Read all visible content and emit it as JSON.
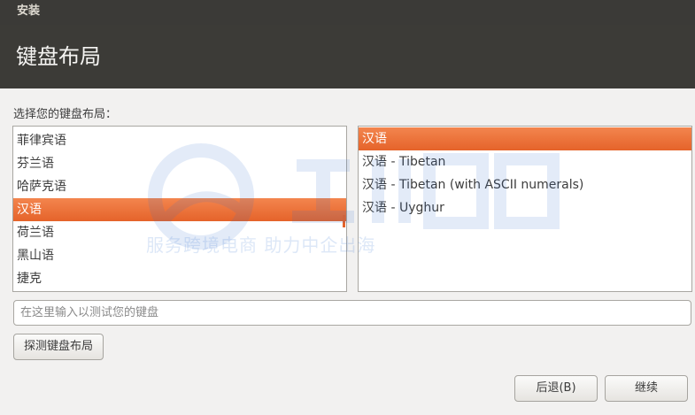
{
  "window": {
    "title": "安装"
  },
  "header": {
    "title": "键盘布局"
  },
  "prompt": "选择您的键盘布局：",
  "layouts": {
    "items": [
      "菲律宾语",
      "芬兰语",
      "哈萨克语",
      "汉语",
      "荷兰语",
      "黑山语",
      "捷克"
    ],
    "selected_index": 3
  },
  "variants": {
    "items": [
      "汉语",
      "汉语 - Tibetan",
      "汉语 - Tibetan (with ASCII numerals)",
      "汉语 - Uyghur"
    ],
    "selected_index": 0
  },
  "test_input": {
    "placeholder": "在这里输入以测试您的键盘",
    "value": ""
  },
  "buttons": {
    "detect": "探测键盘布局",
    "back": "后退(B)",
    "continue": "继续"
  },
  "watermark": {
    "text": "服务跨境电商 助力中企出海"
  },
  "colors": {
    "accent": "#e5632a",
    "titlebar": "#3b3a37",
    "background": "#f2f1f0"
  }
}
